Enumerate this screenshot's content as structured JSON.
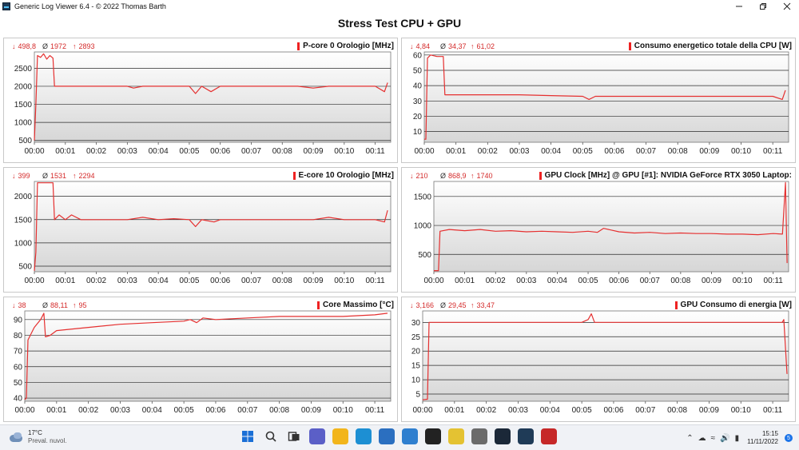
{
  "window": {
    "title": "Generic Log Viewer 6.4 - © 2022 Thomas Barth",
    "minimize_icon": "minimize-icon",
    "maximize_icon": "restore-icon",
    "close_icon": "close-icon"
  },
  "header": {
    "title": "Stress Test CPU + GPU"
  },
  "colors": {
    "series": "#e53030",
    "grid": "#2a2a2a",
    "plot_bg_top": "#ffffff",
    "plot_bg_bottom": "#d6d6d6"
  },
  "panels": [
    {
      "title": "P-core 0 Orologio [MHz]",
      "min": "498,8",
      "avg": "1972",
      "max": "2893",
      "chart_data": {
        "type": "line",
        "x_ticks": [
          "00:00",
          "00:01",
          "00:02",
          "00:03",
          "00:04",
          "00:05",
          "00:06",
          "00:07",
          "00:08",
          "00:09",
          "00:10",
          "00:11"
        ],
        "y_ticks": [
          "500",
          "1000",
          "1500",
          "2000",
          "2500"
        ],
        "ylim": [
          450,
          2950
        ],
        "xlim": [
          0,
          11.5
        ],
        "series": [
          {
            "values": [
              [
                0,
                500
              ],
              [
                0.05,
                1500
              ],
              [
                0.1,
                2850
              ],
              [
                0.2,
                2800
              ],
              [
                0.3,
                2900
              ],
              [
                0.4,
                2750
              ],
              [
                0.5,
                2850
              ],
              [
                0.6,
                2780
              ],
              [
                0.65,
                2000
              ],
              [
                1.0,
                2000
              ],
              [
                1.5,
                2000
              ],
              [
                2.0,
                2000
              ],
              [
                2.5,
                2000
              ],
              [
                3.0,
                2000
              ],
              [
                3.2,
                1950
              ],
              [
                3.5,
                2000
              ],
              [
                4.0,
                2000
              ],
              [
                4.5,
                2000
              ],
              [
                5.0,
                2000
              ],
              [
                5.2,
                1800
              ],
              [
                5.4,
                2000
              ],
              [
                5.7,
                1850
              ],
              [
                6.0,
                2000
              ],
              [
                6.5,
                2000
              ],
              [
                7.0,
                2000
              ],
              [
                7.5,
                2000
              ],
              [
                8.0,
                2000
              ],
              [
                8.5,
                2000
              ],
              [
                9.0,
                1950
              ],
              [
                9.5,
                2000
              ],
              [
                10.0,
                2000
              ],
              [
                10.5,
                2000
              ],
              [
                11.0,
                2000
              ],
              [
                11.3,
                1850
              ],
              [
                11.4,
                2100
              ]
            ]
          }
        ]
      }
    },
    {
      "title": "Consumo energetico totale della CPU [W]",
      "min": "4,84",
      "avg": "34,37",
      "max": "61,02",
      "chart_data": {
        "type": "line",
        "x_ticks": [
          "00:00",
          "00:01",
          "00:02",
          "00:03",
          "00:04",
          "00:05",
          "00:06",
          "00:07",
          "00:08",
          "00:09",
          "00:10",
          "00:11"
        ],
        "y_ticks": [
          "10",
          "20",
          "30",
          "40",
          "50",
          "60"
        ],
        "ylim": [
          3,
          62
        ],
        "xlim": [
          0,
          11.5
        ],
        "series": [
          {
            "values": [
              [
                0,
                5
              ],
              [
                0.05,
                5
              ],
              [
                0.1,
                58
              ],
              [
                0.2,
                60
              ],
              [
                0.4,
                59
              ],
              [
                0.6,
                59
              ],
              [
                0.65,
                34
              ],
              [
                1.0,
                34
              ],
              [
                2.0,
                34
              ],
              [
                3.0,
                34
              ],
              [
                4.0,
                33.5
              ],
              [
                5.0,
                33
              ],
              [
                5.2,
                31
              ],
              [
                5.4,
                33
              ],
              [
                6.0,
                33
              ],
              [
                7.0,
                33
              ],
              [
                8.0,
                33
              ],
              [
                9.0,
                33
              ],
              [
                10.0,
                33
              ],
              [
                11.0,
                33
              ],
              [
                11.3,
                31
              ],
              [
                11.4,
                37
              ]
            ]
          }
        ]
      }
    },
    {
      "title": "E-core 10 Orologio [MHz]",
      "min": "399",
      "avg": "1531",
      "max": "2294",
      "chart_data": {
        "type": "line",
        "x_ticks": [
          "00:00",
          "00:01",
          "00:02",
          "00:03",
          "00:04",
          "00:05",
          "00:06",
          "00:07",
          "00:08",
          "00:09",
          "00:10",
          "00:11"
        ],
        "y_ticks": [
          "500",
          "1000",
          "1500",
          "2000"
        ],
        "ylim": [
          380,
          2320
        ],
        "xlim": [
          0,
          11.5
        ],
        "series": [
          {
            "values": [
              [
                0,
                400
              ],
              [
                0.05,
                800
              ],
              [
                0.1,
                2290
              ],
              [
                0.6,
                2290
              ],
              [
                0.65,
                1500
              ],
              [
                0.8,
                1600
              ],
              [
                1.0,
                1500
              ],
              [
                1.2,
                1600
              ],
              [
                1.5,
                1500
              ],
              [
                2.0,
                1500
              ],
              [
                3.0,
                1500
              ],
              [
                3.5,
                1550
              ],
              [
                4.0,
                1500
              ],
              [
                4.5,
                1520
              ],
              [
                5.0,
                1500
              ],
              [
                5.2,
                1350
              ],
              [
                5.4,
                1500
              ],
              [
                5.8,
                1450
              ],
              [
                6.0,
                1500
              ],
              [
                7.0,
                1500
              ],
              [
                8.0,
                1500
              ],
              [
                9.0,
                1500
              ],
              [
                9.5,
                1550
              ],
              [
                10.0,
                1500
              ],
              [
                11.0,
                1500
              ],
              [
                11.3,
                1450
              ],
              [
                11.4,
                1700
              ]
            ]
          }
        ]
      }
    },
    {
      "title": "GPU Clock [MHz] @ GPU [#1]: NVIDIA GeForce RTX 3050 Laptop:",
      "min": "210",
      "avg": "868,9",
      "max": "1740",
      "chart_data": {
        "type": "line",
        "x_ticks": [
          "00:00",
          "00:01",
          "00:02",
          "00:03",
          "00:04",
          "00:05",
          "00:06",
          "00:07",
          "00:08",
          "00:09",
          "00:10",
          "00:11"
        ],
        "y_ticks": [
          "500",
          "1000",
          "1500"
        ],
        "ylim": [
          200,
          1760
        ],
        "xlim": [
          0,
          11.5
        ],
        "series": [
          {
            "values": [
              [
                0,
                220
              ],
              [
                0.15,
                220
              ],
              [
                0.2,
                900
              ],
              [
                0.5,
                930
              ],
              [
                1.0,
                910
              ],
              [
                1.5,
                930
              ],
              [
                2.0,
                900
              ],
              [
                2.5,
                910
              ],
              [
                3.0,
                890
              ],
              [
                3.5,
                900
              ],
              [
                4.0,
                890
              ],
              [
                4.5,
                880
              ],
              [
                5.0,
                900
              ],
              [
                5.3,
                880
              ],
              [
                5.5,
                950
              ],
              [
                6.0,
                890
              ],
              [
                6.5,
                870
              ],
              [
                7.0,
                880
              ],
              [
                7.5,
                860
              ],
              [
                8.0,
                870
              ],
              [
                8.5,
                860
              ],
              [
                9.0,
                860
              ],
              [
                9.5,
                850
              ],
              [
                10.0,
                850
              ],
              [
                10.5,
                840
              ],
              [
                11.0,
                860
              ],
              [
                11.3,
                850
              ],
              [
                11.4,
                1740
              ],
              [
                11.45,
                350
              ]
            ]
          }
        ]
      }
    },
    {
      "title": "Core Massimo [°C]",
      "min": "38",
      "avg": "88,11",
      "max": "95",
      "chart_data": {
        "type": "line",
        "x_ticks": [
          "00:00",
          "00:01",
          "00:02",
          "00:03",
          "00:04",
          "00:05",
          "00:06",
          "00:07",
          "00:08",
          "00:09",
          "00:10",
          "00:11"
        ],
        "y_ticks": [
          "40",
          "50",
          "60",
          "70",
          "80",
          "90"
        ],
        "ylim": [
          38,
          95.5
        ],
        "xlim": [
          0,
          11.5
        ],
        "series": [
          {
            "values": [
              [
                0,
                39
              ],
              [
                0.05,
                40
              ],
              [
                0.1,
                77
              ],
              [
                0.3,
                85
              ],
              [
                0.5,
                90
              ],
              [
                0.6,
                94
              ],
              [
                0.65,
                79
              ],
              [
                0.8,
                80
              ],
              [
                1.0,
                83
              ],
              [
                2.0,
                85
              ],
              [
                3.0,
                87
              ],
              [
                4.0,
                88
              ],
              [
                5.0,
                89
              ],
              [
                5.2,
                90
              ],
              [
                5.4,
                88
              ],
              [
                5.6,
                91
              ],
              [
                6.0,
                90
              ],
              [
                7.0,
                91
              ],
              [
                8.0,
                92
              ],
              [
                9.0,
                92
              ],
              [
                10.0,
                92
              ],
              [
                11.0,
                93
              ],
              [
                11.4,
                94
              ]
            ]
          }
        ]
      }
    },
    {
      "title": "GPU Consumo di energia [W]",
      "min": "3,166",
      "avg": "29,45",
      "max": "33,47",
      "chart_data": {
        "type": "line",
        "x_ticks": [
          "00:00",
          "00:01",
          "00:02",
          "00:03",
          "00:04",
          "00:05",
          "00:06",
          "00:07",
          "00:08",
          "00:09",
          "00:10",
          "00:11"
        ],
        "y_ticks": [
          "5",
          "10",
          "15",
          "20",
          "25",
          "30"
        ],
        "ylim": [
          2.5,
          34
        ],
        "xlim": [
          0,
          11.5
        ],
        "series": [
          {
            "values": [
              [
                0,
                3
              ],
              [
                0.15,
                3.2
              ],
              [
                0.2,
                30
              ],
              [
                1.0,
                30
              ],
              [
                2.0,
                30
              ],
              [
                3.0,
                30
              ],
              [
                4.0,
                30
              ],
              [
                5.0,
                30
              ],
              [
                5.2,
                31
              ],
              [
                5.3,
                33
              ],
              [
                5.4,
                30
              ],
              [
                6.0,
                30
              ],
              [
                7.0,
                30
              ],
              [
                8.0,
                30
              ],
              [
                9.0,
                30
              ],
              [
                10.0,
                30
              ],
              [
                11.0,
                30
              ],
              [
                11.3,
                30
              ],
              [
                11.35,
                31
              ],
              [
                11.45,
                12
              ]
            ]
          }
        ]
      }
    }
  ],
  "taskbar": {
    "weather_icon": "cloud-icon",
    "temperature": "17°C",
    "forecast": "Preval. nuvol.",
    "apps": [
      {
        "icon": "windows-start-icon",
        "color": "#1a6fd6"
      },
      {
        "icon": "search-icon",
        "color": "#333333"
      },
      {
        "icon": "task-view-icon",
        "color": "#333333"
      },
      {
        "icon": "chat-icon",
        "color": "#5b5fc7"
      },
      {
        "icon": "file-explorer-icon",
        "color": "#f2b51c"
      },
      {
        "icon": "edge-icon",
        "color": "#1d8fd3"
      },
      {
        "icon": "store-icon",
        "color": "#2b6fc0"
      },
      {
        "icon": "app-icon",
        "color": "#2f7fcf"
      },
      {
        "icon": "xbox-icon",
        "color": "#222222"
      },
      {
        "icon": "hwinfo-icon",
        "color": "#e4c232"
      },
      {
        "icon": "gpu-z-icon",
        "color": "#6b6b6b"
      },
      {
        "icon": "steam-icon",
        "color": "#1b2838"
      },
      {
        "icon": "log-viewer-icon",
        "color": "#1f3b57"
      },
      {
        "icon": "furmark-icon",
        "color": "#c62828"
      }
    ],
    "time": "15:15",
    "date": "11/11/2022",
    "notifications": "5"
  }
}
